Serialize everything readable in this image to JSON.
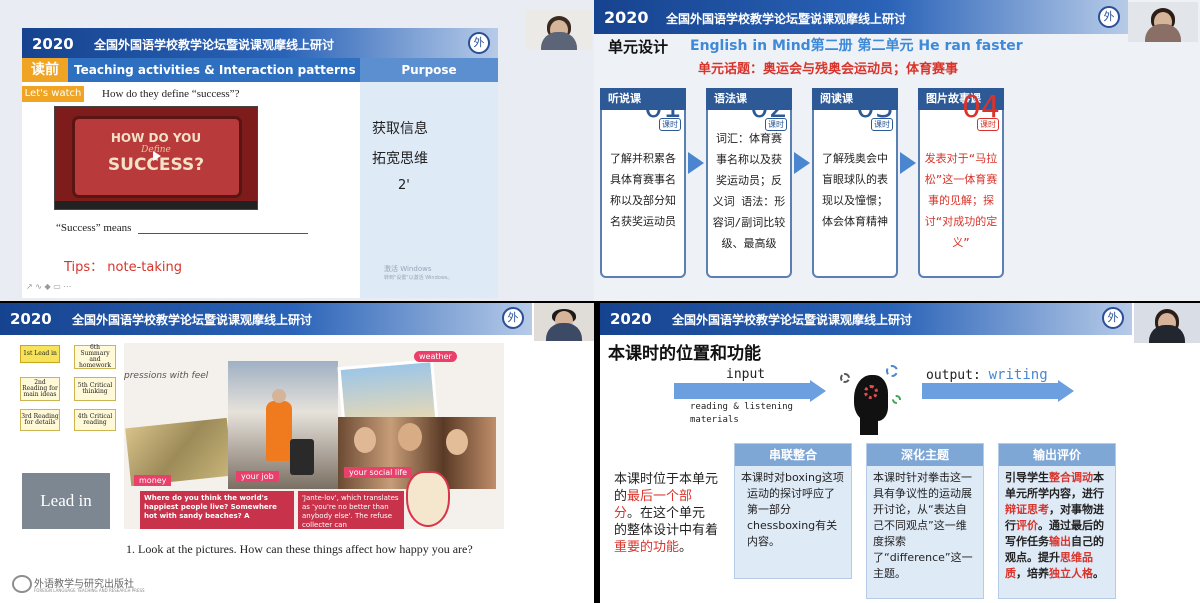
{
  "banner": {
    "year": "2020",
    "title": "全国外国语学校教学论坛暨说课观摩线上研讨",
    "seal": "外"
  },
  "tl": {
    "read_tag": "读前",
    "header": "Teaching activities & Interaction patterns",
    "purpose_header": "Purpose",
    "lets_watch": "Let's watch",
    "question": "How do they define “success”?",
    "video_line1": "HOW DO YOU",
    "video_line2": "Define",
    "video_line3": "SUCCESS?",
    "success_means": "“Success” means",
    "tips": "Tips： note-taking",
    "purpose_items": [
      "获取信息",
      "拓宽思维"
    ],
    "time": "2'",
    "watermark1": "激活 Windows",
    "watermark2": "转到\"设置\"以激活 Windows。"
  },
  "tr": {
    "label": "单元设计",
    "title": "English in Mind第二册 第二单元 He ran faster",
    "topic": "单元话题：奥运会与残奥会运动员；体育赛事",
    "ks": "课时",
    "units": [
      {
        "header": "听说课",
        "num": "01",
        "text": "了解并积累各具体育赛事名称以及部分知名获奖运动员"
      },
      {
        "header": "语法课",
        "num": "02",
        "text": "词汇：体育赛事名称以及获奖运动员；反义词 语法：形容词/副词比较级、最高级"
      },
      {
        "header": "阅读课",
        "num": "03",
        "text": "了解残奥会中盲眼球队的表现以及憧憬；体会体育精神"
      },
      {
        "header": "图片故事课",
        "num": "04",
        "text": "发表对于“马拉松”这一体育赛事的见解；探讨“对成功的定义”"
      }
    ]
  },
  "bl": {
    "flow": [
      {
        "label": "1st Lead in"
      },
      {
        "label": "6th Summary and homework"
      },
      {
        "label": "2nd Reading for main ideas"
      },
      {
        "label": "5th Critical thinking"
      },
      {
        "label": "3rd Reading for details"
      },
      {
        "label": "4th Critical reading"
      }
    ],
    "lead_in": "Lead in",
    "collage": {
      "expressions": "pressions with feel",
      "weather": "weather",
      "money": "money",
      "your_job": "your job",
      "your_social_life": "your social life",
      "caption_left": "Where do you think the world's happiest people live? Somewhere hot with sandy beaches? A",
      "caption_right": "'Jante-lov', which translates as 'you're no better than anybody else'. The refuse collecter can"
    },
    "question": "1. Look at the pictures. How can these things affect how happy you are?",
    "publisher_cn": "外语教学与研究出版社",
    "publisher_en": "FOREIGN LANGUAGE TEACHING AND RESEARCH PRESS"
  },
  "br": {
    "title": "本课时的位置和功能",
    "input": "input",
    "input_sub": "reading & listening materials",
    "output_label": "output:",
    "output_value": "writing",
    "left_text_a": "本课时位于本单元的",
    "left_text_b": "最后一个部分",
    "left_text_c": "。在这个单元的整体设计中有着",
    "left_text_d": "重要的功能",
    "left_text_e": "。",
    "col1_head": "串联整合",
    "col1_text": "本课时对boxing这项运动的探讨呼应了第一部分chessboxing有关内容。",
    "col2_head": "深化主题",
    "col2_text": "本课时针对拳击这一具有争议性的运动展开讨论，从“表达自己不同观点”这一维度探索了“difference”这一主题。",
    "col3_head": "输出评价",
    "col3_a": "引导学生",
    "col3_b": "整合调动",
    "col3_c": "本单元所学内容，进行",
    "col3_d": "辩证思考",
    "col3_e": "，对事物进行",
    "col3_f": "评价",
    "col3_g": "。通过最后的写作任务",
    "col3_h": "输出",
    "col3_i": "自己的观点。提升",
    "col3_j": "思维品质",
    "col3_k": "，培养",
    "col3_l": "独立人格",
    "col3_m": "。"
  },
  "colors": {
    "banner_blue": "#16438f",
    "accent_red": "#d9342b",
    "accent_blue": "#2d5a97"
  }
}
